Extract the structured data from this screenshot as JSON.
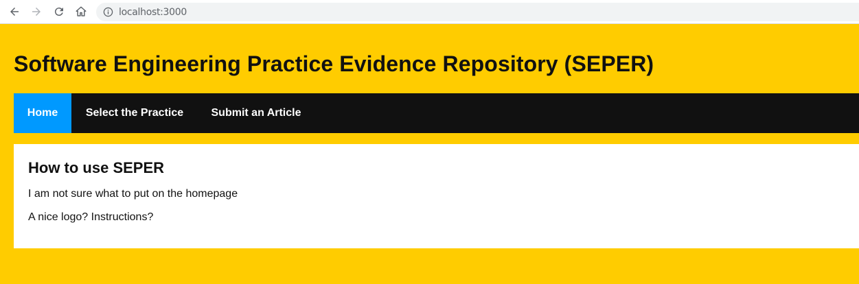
{
  "browser": {
    "url": "localhost:3000",
    "icons": [
      "back-arrow-icon",
      "forward-arrow-icon",
      "reload-icon",
      "home-icon",
      "info-icon"
    ]
  },
  "header": {
    "title": "Software Engineering Practice Evidence Repository (SEPER)"
  },
  "nav": {
    "items": [
      {
        "label": "Home",
        "active": true
      },
      {
        "label": "Select the Practice",
        "active": false
      },
      {
        "label": "Submit an Article",
        "active": false
      }
    ]
  },
  "content": {
    "heading": "How to use SEPER",
    "paragraphs": [
      "I am not sure what to put on the homepage",
      "A nice logo? Instructions?"
    ]
  },
  "colors": {
    "page_background": "#ffcc00",
    "nav_background": "#111111",
    "nav_active": "#0099ff",
    "card_background": "#ffffff"
  }
}
